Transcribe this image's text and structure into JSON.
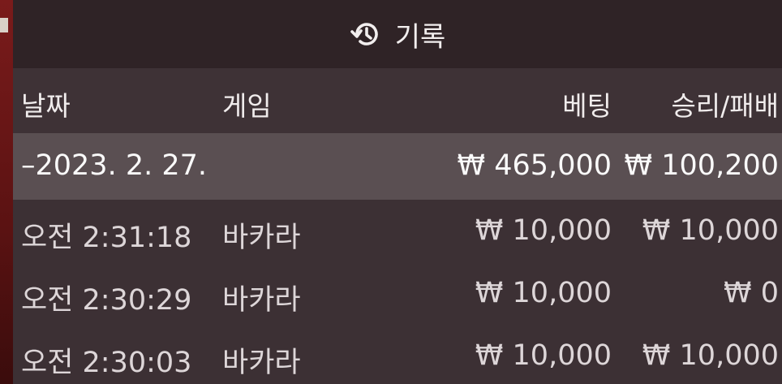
{
  "header": {
    "title": "기록",
    "icon": "history-icon"
  },
  "columns": {
    "date": "날짜",
    "game": "게임",
    "bet": "베팅",
    "winloss": "승리/패배"
  },
  "summary": {
    "date": "–2023. 2. 27.",
    "bet": "₩ 465,000",
    "winloss": "₩ 100,200"
  },
  "rows": [
    {
      "time": "오전 2:31:18",
      "game": "바카라",
      "bet": "₩ 10,000",
      "winloss": "₩ 10,000"
    },
    {
      "time": "오전 2:30:29",
      "game": "바카라",
      "bet": "₩ 10,000",
      "winloss": "₩ 0"
    },
    {
      "time": "오전 2:30:03",
      "game": "바카라",
      "bet": "₩ 10,000",
      "winloss": "₩ 10,000"
    }
  ],
  "colors": {
    "header_bg": "#2f2326",
    "summary_bg": "#5a4f52",
    "panel_bg": "#3c3034"
  }
}
